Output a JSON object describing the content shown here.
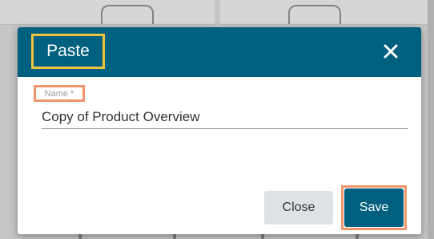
{
  "dialog": {
    "title": "Paste",
    "close_icon": "close-icon",
    "field": {
      "label": "Name *",
      "value": "Copy of Product Overview"
    },
    "buttons": {
      "close_label": "Close",
      "save_label": "Save"
    }
  },
  "colors": {
    "header": "#00607f",
    "primary_button": "#00607f",
    "secondary_button": "#dfe2e5",
    "highlight_title": "#f0c43c",
    "highlight_field_and_save": "#f0956b"
  }
}
